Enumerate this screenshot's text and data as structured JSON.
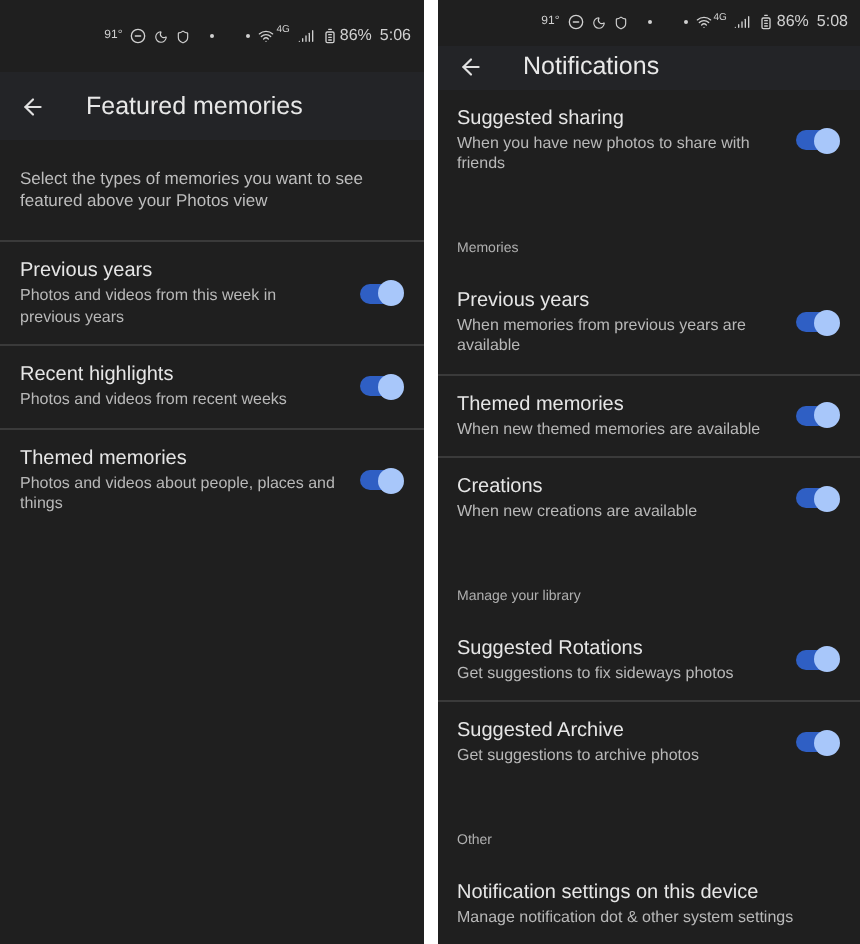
{
  "screens": [
    {
      "status_bar": {
        "temperature": "91°",
        "network": "4G",
        "battery": "86%",
        "time": "5:06"
      },
      "title": "Featured memories",
      "items": [
        {
          "kind": "intro",
          "text": "Select the types of memories you want to see featured above your Photos view"
        },
        {
          "kind": "toggle",
          "title": "Previous years",
          "subtitle": "Photos and videos from this week in previous years",
          "on": true
        },
        {
          "kind": "toggle",
          "title": "Recent highlights",
          "subtitle": "Photos and videos from recent weeks",
          "on": true
        },
        {
          "kind": "toggle",
          "title": "Themed memories",
          "subtitle": "Photos and videos about people, places and things",
          "on": true
        }
      ]
    },
    {
      "status_bar": {
        "temperature": "91°",
        "network": "4G",
        "battery": "86%",
        "time": "5:08"
      },
      "title": "Notifications",
      "items": [
        {
          "kind": "toggle",
          "title": "Suggested sharing",
          "subtitle": "When you have new photos to share with friends",
          "on": true
        },
        {
          "kind": "section",
          "text": "Memories"
        },
        {
          "kind": "toggle",
          "title": "Previous years",
          "subtitle": "When memories from previous years are available",
          "on": true
        },
        {
          "kind": "toggle",
          "title": "Themed memories",
          "subtitle": "When new themed memories are available",
          "on": true
        },
        {
          "kind": "toggle",
          "title": "Creations",
          "subtitle": "When new creations are available",
          "on": true
        },
        {
          "kind": "section",
          "text": "Manage your library"
        },
        {
          "kind": "toggle",
          "title": "Suggested Rotations",
          "subtitle": "Get suggestions to fix sideways photos",
          "on": true
        },
        {
          "kind": "toggle",
          "title": "Suggested Archive",
          "subtitle": "Get suggestions to archive photos",
          "on": true
        },
        {
          "kind": "section",
          "text": "Other"
        },
        {
          "kind": "link",
          "title": "Notification settings on this device",
          "subtitle": "Manage notification dot & other system settings"
        }
      ]
    }
  ]
}
